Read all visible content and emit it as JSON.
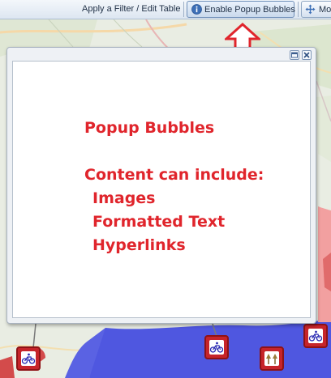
{
  "toolbar": {
    "filter_label": "Apply a Filter / Edit Table",
    "popup_button_label": "Enable Popup Bubbles",
    "move_button_label": "Mo"
  },
  "popup": {
    "title": "Popup Bubbles",
    "subtitle": "Content can include:",
    "items": [
      "Images",
      "Formatted Text",
      "Hyperlinks"
    ]
  },
  "colors": {
    "content_text": "#e0252c",
    "arrow": "#e0252c",
    "marker": "#c6242a",
    "map_blue": "#4f57e0",
    "map_red": "#f2a0a0"
  },
  "icons": {
    "popup_button": "info-icon",
    "move_button": "move-icon",
    "popup_dock": "dock-icon",
    "popup_close": "close-icon"
  },
  "markers": [
    {
      "name": "cycle-marker",
      "icon": "bicycle-icon"
    },
    {
      "name": "cycle-marker",
      "icon": "bicycle-icon"
    },
    {
      "name": "cycle-marker",
      "icon": "bicycle-icon"
    },
    {
      "name": "tree-marker",
      "icon": "tree-icon"
    }
  ]
}
